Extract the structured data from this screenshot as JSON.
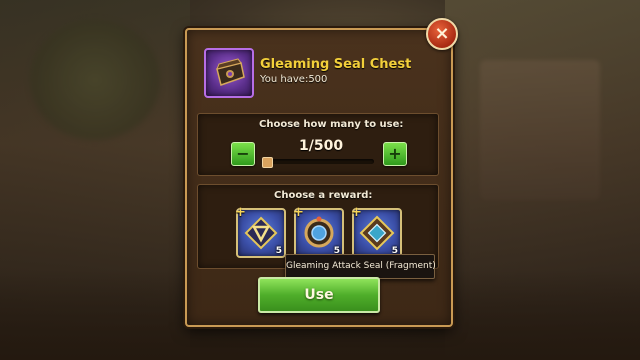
{
  "dialog": {
    "close_label": "×",
    "item": {
      "name": "Gleaming Seal Chest",
      "owned_text": "You have:500",
      "icon": "chest-icon",
      "rarity_color": "#b76ee6"
    },
    "quantity": {
      "prompt": "Choose how many to use:",
      "minus_label": "−",
      "plus_label": "+",
      "value_text": "1/500",
      "current": 1,
      "max": 500
    },
    "rewards": {
      "prompt": "Choose a reward:",
      "items": [
        {
          "icon": "attack-seal-fragment-icon",
          "count": "5"
        },
        {
          "icon": "seal-fragment-icon",
          "count": "5"
        },
        {
          "icon": "seal-fragment-icon",
          "count": "5"
        }
      ]
    },
    "tooltip": "Gleaming Attack Seal (Fragment)",
    "use_label": "Use"
  },
  "colors": {
    "title": "#f2cf3a",
    "button_green": "#4fae2a",
    "close_red": "#a92a13",
    "panel_border": "#c99a54"
  }
}
